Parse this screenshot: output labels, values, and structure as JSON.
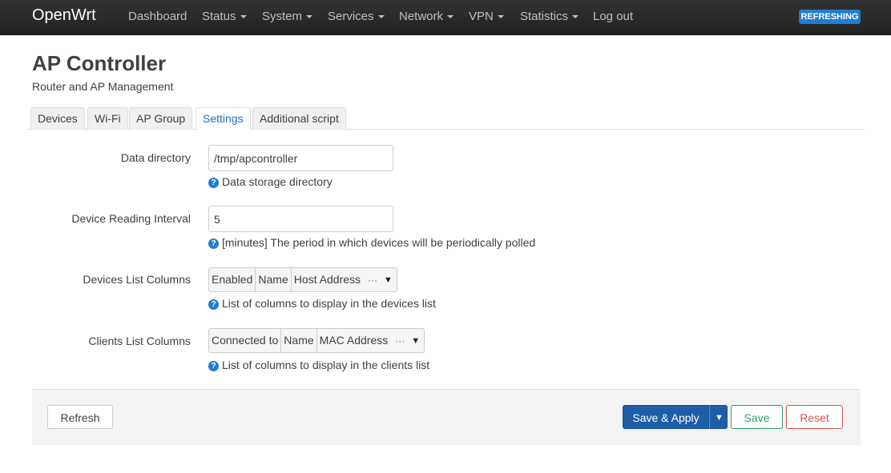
{
  "brand": "OpenWrt",
  "nav": [
    "Dashboard",
    "Status",
    "System",
    "Services",
    "Network",
    "VPN",
    "Statistics",
    "Log out"
  ],
  "status_badge": "REFRESHING",
  "page": {
    "title": "AP Controller",
    "description": "Router and AP Management"
  },
  "tabs": [
    "Devices",
    "Wi-Fi",
    "AP Group",
    "Settings",
    "Additional script"
  ],
  "active_tab": "Settings",
  "fields": {
    "data_directory": {
      "label": "Data directory",
      "value": "/tmp/apcontroller",
      "help": "Data storage directory"
    },
    "reading_interval": {
      "label": "Device Reading Interval",
      "value": "5",
      "help": "[minutes] The period in which devices will be periodically polled"
    },
    "devices_columns": {
      "label": "Devices List Columns",
      "selected": [
        "Enabled",
        "Name",
        "Host Address"
      ],
      "help": "List of columns to display in the devices list"
    },
    "clients_columns": {
      "label": "Clients List Columns",
      "selected": [
        "Connected to",
        "Name",
        "MAC Address"
      ],
      "help": "List of columns to display in the clients list"
    }
  },
  "buttons": {
    "refresh": "Refresh",
    "save_apply": "Save & Apply",
    "save": "Save",
    "reset": "Reset"
  },
  "colors": {
    "navbar": "#222222",
    "accent": "#1f7ed0",
    "primary_button": "#1e5ea8",
    "save": "#2ea06a",
    "reset": "#d9534f"
  }
}
